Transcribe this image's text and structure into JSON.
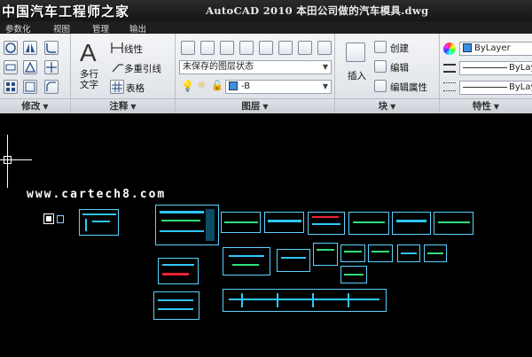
{
  "window": {
    "title": "AutoCAD 2010   本田公司做的汽车模具.dwg",
    "watermark": "中国汽车工程师之家"
  },
  "ribbon_tabs": [
    "参数化",
    "视图",
    "管理",
    "输出"
  ],
  "panels": {
    "modify": {
      "label": "修改"
    },
    "annotation": {
      "label": "注释",
      "multiline_text": "多行文字",
      "linear": "线性",
      "multileader": "多重引线",
      "table": "表格"
    },
    "layers": {
      "label": "图层",
      "layer_state": "未保存的图层状态",
      "current_layer": "-B"
    },
    "block": {
      "label": "块",
      "insert": "插入",
      "create": "创建",
      "edit": "编辑",
      "edit_attributes": "编辑属性"
    },
    "properties": {
      "label": "特性",
      "color": "ByLayer",
      "linetype": "ByLayer",
      "lineweight": "ByLayer"
    }
  },
  "canvas": {
    "watermark_url": "www.cartech8.com",
    "background": "#000000",
    "drawing_color": "#2ec7ff"
  },
  "colors": {
    "ribbon": "#e6e9ed",
    "titlebar": "#1f1f1f"
  }
}
